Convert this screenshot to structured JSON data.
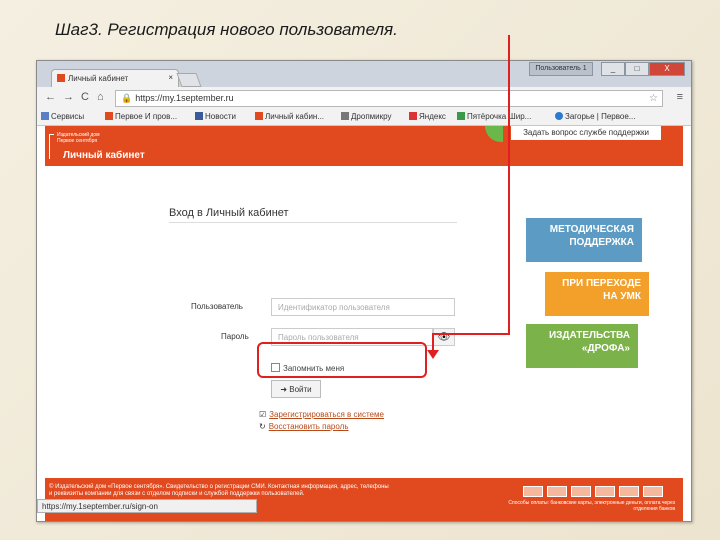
{
  "slide": {
    "title": "Шаг3. Регистрация нового пользователя."
  },
  "browser": {
    "tab_title": "Личный кабинет",
    "profile_label": "Пользователь 1",
    "url": "https://my.1september.ru",
    "bookmarks": [
      "Сервисы",
      "Первое И пров...",
      "Новости",
      "Личный кабин...",
      "Дропмикру",
      "Яндекс",
      "Пятёрочка Шир...",
      "Загорье | Первое..."
    ],
    "status_url": "https://my.1september.ru/sign-on"
  },
  "site": {
    "logo_line1": "Издательский дом",
    "logo_line2": "Первое сентября",
    "cabinet_title": "Личный кабинет",
    "ask_button": "Задать вопрос службе поддержки",
    "login": {
      "title": "Вход в Личный кабинет",
      "user_label": "Пользователь",
      "user_placeholder": "Идентификатор пользователя",
      "password_label": "Пароль",
      "password_placeholder": "Пароль пользователя",
      "remember_label": "Запомнить меня",
      "login_button": "Войти",
      "register_link": "Зарегистрироваться в системе",
      "forgot_link": "Восстановить пароль"
    },
    "promos": [
      {
        "line1": "МЕТОДИЧЕСКАЯ",
        "line2": "ПОДДЕРЖКА",
        "color": "#5b9bc4"
      },
      {
        "line1": "ПРИ ПЕРЕХОДЕ",
        "line2": "НА УМК",
        "color": "#f2a02a"
      },
      {
        "line1": "ИЗДАТЕЛЬСТВА",
        "line2": "«ДРОФА»",
        "color": "#7cb24a"
      }
    ],
    "footer_text": "© Издательский дом «Первое сентября». Свидетельство о регистрации СМИ. Контактная информация, адрес, телефоны и реквизиты компании для связи с отделом подписки и службой поддержки пользователей.",
    "footer_right": "Способы оплаты: банковские карты, электронные деньги, оплата через отделения банков"
  },
  "colors": {
    "brand": "#e04a1e",
    "annotation": "#e02020"
  }
}
